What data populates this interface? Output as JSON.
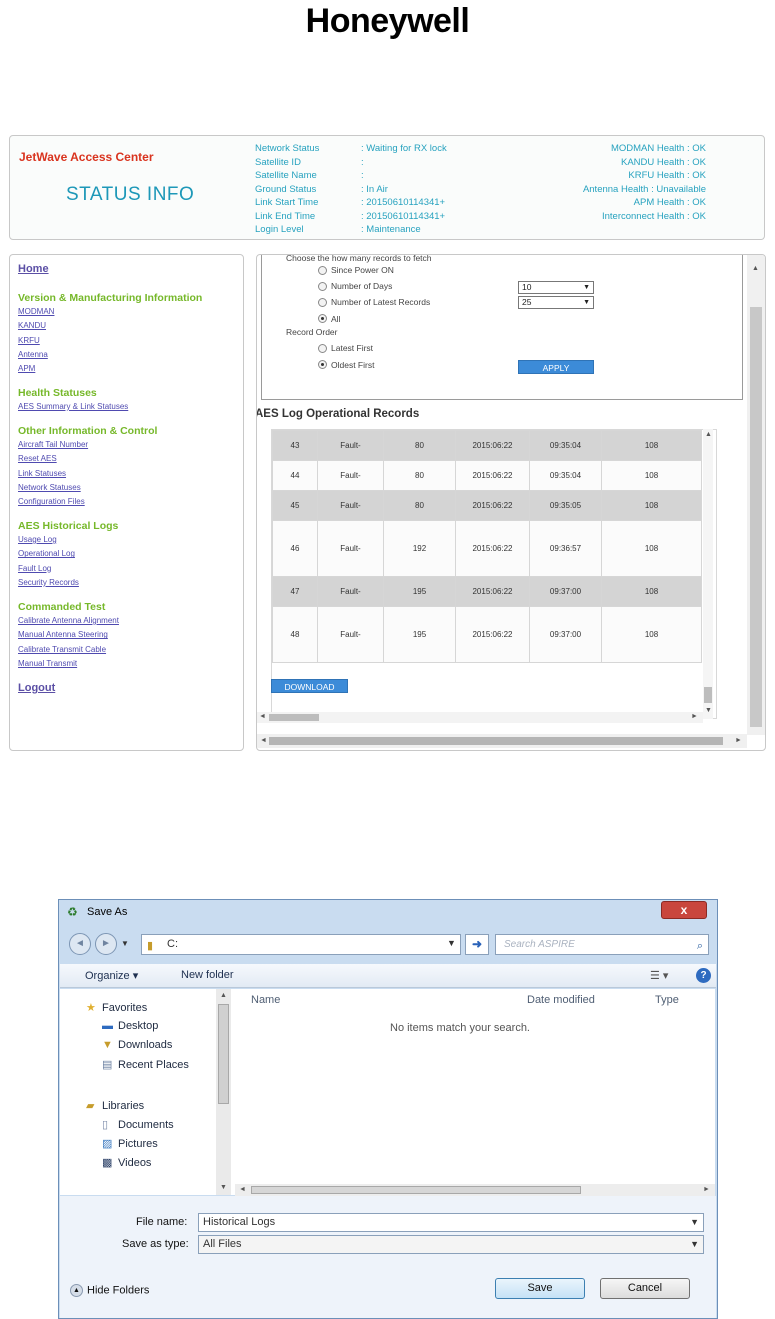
{
  "brand": {
    "logo_text": "Honeywell"
  },
  "app": {
    "title": "JetWave Access Center",
    "page_heading": "STATUS INFO",
    "status": [
      {
        "label": "Network Status",
        "value": ": Waiting for RX lock"
      },
      {
        "label": "Satellite ID",
        "value": ":"
      },
      {
        "label": "Satellite Name",
        "value": ":"
      },
      {
        "label": "Ground Status",
        "value": ": In Air"
      },
      {
        "label": "Link Start Time",
        "value": ": 20150610114341+"
      },
      {
        "label": "Link End Time",
        "value": ": 20150610114341+"
      },
      {
        "label": "Login Level",
        "value": ": Maintenance"
      }
    ],
    "health": [
      "MODMAN Health : OK",
      "KANDU Health : OK",
      "KRFU Health : OK",
      "Antenna Health : Unavailable",
      "APM Health : OK",
      "Interconnect Health : OK"
    ],
    "sidebar": {
      "home": "Home",
      "sections": [
        {
          "heading": "Version & Manufacturing Information",
          "links": [
            "MODMAN",
            "KANDU",
            "KRFU",
            "Antenna",
            "APM"
          ]
        },
        {
          "heading": "Health Statuses",
          "links": [
            "AES Summary & Link Statuses"
          ]
        },
        {
          "heading": "Other Information & Control",
          "links": [
            "Aircraft Tail Number",
            "Reset AES",
            "Link Statuses",
            "Network Statuses",
            "Configuration Files"
          ]
        },
        {
          "heading": "AES Historical Logs",
          "links": [
            "Usage Log",
            "Operational Log",
            "Fault Log",
            "Security Records"
          ]
        },
        {
          "heading": "Commanded Test",
          "links": [
            "Calibrate Antenna Alignment",
            "Manual Antenna Steering",
            "Calibrate Transmit Cable",
            "Manual Transmit"
          ]
        }
      ],
      "logout": "Logout"
    },
    "filter": {
      "fetch_prompt": "Choose the how many records to fetch",
      "opt_power_on": "Since Power ON",
      "opt_days": "Number of Days",
      "opt_latest": "Number of Latest Records",
      "opt_all": "All",
      "days_value": "10",
      "latest_value": "25",
      "order_label": "Record Order",
      "order_latest": "Latest First",
      "order_oldest": "Oldest First",
      "apply": "APPLY"
    },
    "ops": {
      "title": "AES Log Operational Records",
      "rows": [
        [
          "43",
          "Fault-",
          "80",
          "2015:06:22",
          "09:35:04",
          "108"
        ],
        [
          "44",
          "Fault-",
          "80",
          "2015:06:22",
          "09:35:04",
          "108"
        ],
        [
          "45",
          "Fault-",
          "80",
          "2015:06:22",
          "09:35:05",
          "108"
        ],
        [
          "46",
          "Fault-",
          "192",
          "2015:06:22",
          "09:36:57",
          "108"
        ],
        [
          "47",
          "Fault-",
          "195",
          "2015:06:22",
          "09:37:00",
          "108"
        ],
        [
          "48",
          "Fault-",
          "195",
          "2015:06:22",
          "09:37:00",
          "108"
        ]
      ],
      "download": "DOWNLOAD"
    }
  },
  "dialog": {
    "title": "Save As",
    "close": "x",
    "address": "C:",
    "search_placeholder": "Search ASPIRE",
    "organize": "Organize ▾",
    "new_folder": "New folder",
    "nav": {
      "favorites": "Favorites",
      "desktop": "Desktop",
      "downloads": "Downloads",
      "recent": "Recent Places",
      "libraries": "Libraries",
      "documents": "Documents",
      "pictures": "Pictures",
      "videos": "Videos"
    },
    "columns": {
      "name": "Name",
      "date": "Date modified",
      "type": "Type"
    },
    "empty_message": "No items match your search.",
    "file_name_label": "File name:",
    "file_name_value": "Historical Logs",
    "save_type_label": "Save as type:",
    "save_type_value": "All Files",
    "hide_folders": "Hide Folders",
    "save": "Save",
    "cancel": "Cancel"
  }
}
